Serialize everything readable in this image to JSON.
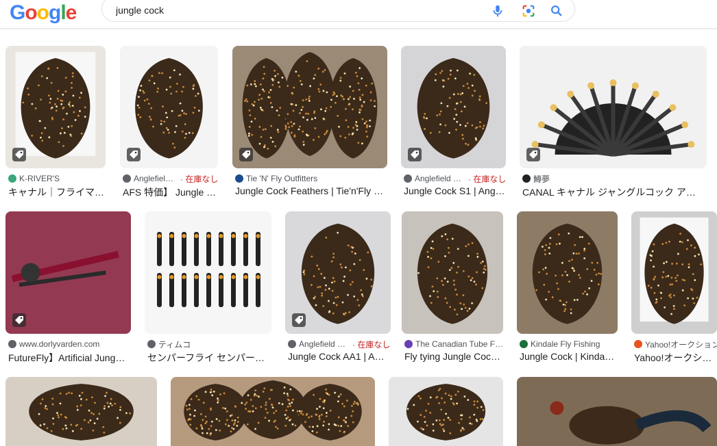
{
  "logo": {
    "text": "Google",
    "letters": [
      "G",
      "o",
      "o",
      "g",
      "l",
      "e"
    ],
    "colors": [
      "#4285f4",
      "#ea4335",
      "#fbbc05",
      "#4285f4",
      "#34a853",
      "#ea4335"
    ]
  },
  "search": {
    "query": "jungle cock",
    "placeholder": ""
  },
  "icons": {
    "mic": "mic-icon",
    "lens": "google-lens-icon",
    "search": "search-icon",
    "tag": "price-tag-icon"
  },
  "stock_label": "在庫なし",
  "results": [
    {
      "source": "K-RIVER'S",
      "title": "キャナル｜フライマ…",
      "stock": false,
      "tag": true
    },
    {
      "source": "Anglefiel…",
      "title": "AFS 特価】 Jungle …",
      "stock": true,
      "tag": true
    },
    {
      "source": "Tie 'N' Fly Outfitters",
      "title": "Jungle Cock Feathers | Tie'n'Fly …",
      "stock": false,
      "tag": true
    },
    {
      "source": "Anglefield …",
      "title": "Jungle Cock S1 | Ang…",
      "stock": true,
      "tag": true
    },
    {
      "source": "鱒夢",
      "title": "CANAL キャナル ジャングルコック ア…",
      "stock": false,
      "tag": true
    },
    {
      "source": "www.dorlyvarden.com",
      "title": "FutureFly】Artificial Jung…",
      "stock": false,
      "tag": true
    },
    {
      "source": "ティムコ",
      "title": "センパーフライ センパー…",
      "stock": false,
      "tag": false
    },
    {
      "source": "Anglefield …",
      "title": "Jungle Cock AA1 | A…",
      "stock": true,
      "tag": true
    },
    {
      "source": "The Canadian Tube F…",
      "title": "Fly tying Jungle Coc…",
      "stock": false,
      "tag": false
    },
    {
      "source": "Kindale Fly Fishing",
      "title": "Jungle Cock | Kinda…",
      "stock": false,
      "tag": false
    },
    {
      "source": "Yahoo!オークション",
      "title": "Yahoo!オークショ…",
      "stock": false,
      "tag": false
    }
  ]
}
